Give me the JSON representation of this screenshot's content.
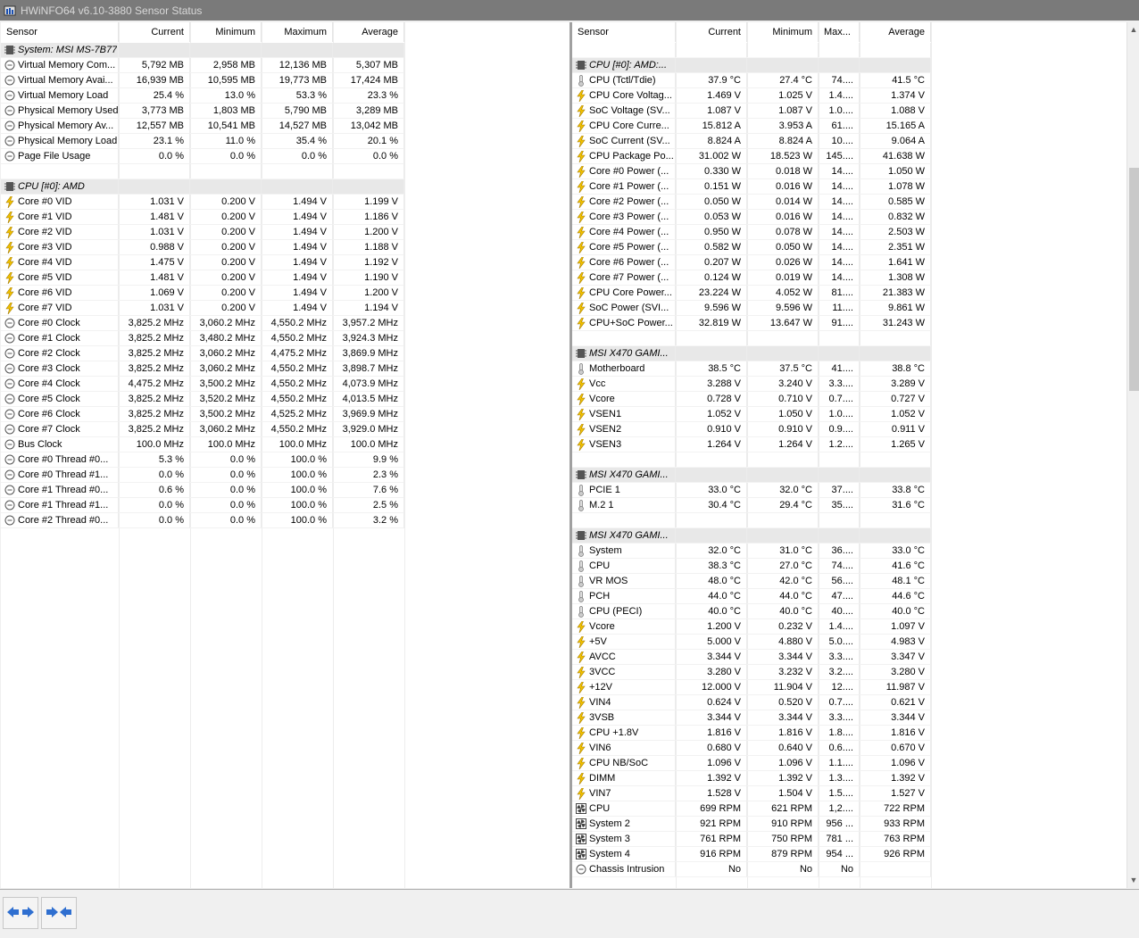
{
  "window": {
    "title": "HWiNFO64 v6.10-3880 Sensor Status"
  },
  "headers": {
    "sensor": "Sensor",
    "current": "Current",
    "minimum": "Minimum",
    "maximum": "Maximum",
    "maximum_short": "Max...",
    "average": "Average"
  },
  "left_rows": [
    {
      "type": "group",
      "name": "System: MSI MS-7B77"
    },
    {
      "type": "row",
      "icon": "circle",
      "name": "Virtual Memory Com...",
      "cur": "5,792 MB",
      "min": "2,958 MB",
      "max": "12,136 MB",
      "avg": "5,307 MB"
    },
    {
      "type": "row",
      "icon": "circle",
      "name": "Virtual Memory Avai...",
      "cur": "16,939 MB",
      "min": "10,595 MB",
      "max": "19,773 MB",
      "avg": "17,424 MB"
    },
    {
      "type": "row",
      "icon": "circle",
      "name": "Virtual Memory Load",
      "cur": "25.4 %",
      "min": "13.0 %",
      "max": "53.3 %",
      "avg": "23.3 %"
    },
    {
      "type": "row",
      "icon": "circle",
      "name": "Physical Memory Used",
      "cur": "3,773 MB",
      "min": "1,803 MB",
      "max": "5,790 MB",
      "avg": "3,289 MB"
    },
    {
      "type": "row",
      "icon": "circle",
      "name": "Physical Memory Av...",
      "cur": "12,557 MB",
      "min": "10,541 MB",
      "max": "14,527 MB",
      "avg": "13,042 MB"
    },
    {
      "type": "row",
      "icon": "circle",
      "name": "Physical Memory Load",
      "cur": "23.1 %",
      "min": "11.0 %",
      "max": "35.4 %",
      "avg": "20.1 %"
    },
    {
      "type": "row",
      "icon": "circle",
      "name": "Page File Usage",
      "cur": "0.0 %",
      "min": "0.0 %",
      "max": "0.0 %",
      "avg": "0.0 %"
    },
    {
      "type": "blank"
    },
    {
      "type": "group",
      "name": "CPU [#0]: AMD"
    },
    {
      "type": "row",
      "icon": "bolt",
      "name": "Core #0 VID",
      "cur": "1.031 V",
      "min": "0.200 V",
      "max": "1.494 V",
      "avg": "1.199 V"
    },
    {
      "type": "row",
      "icon": "bolt",
      "name": "Core #1 VID",
      "cur": "1.481 V",
      "min": "0.200 V",
      "max": "1.494 V",
      "avg": "1.186 V"
    },
    {
      "type": "row",
      "icon": "bolt",
      "name": "Core #2 VID",
      "cur": "1.031 V",
      "min": "0.200 V",
      "max": "1.494 V",
      "avg": "1.200 V"
    },
    {
      "type": "row",
      "icon": "bolt",
      "name": "Core #3 VID",
      "cur": "0.988 V",
      "min": "0.200 V",
      "max": "1.494 V",
      "avg": "1.188 V"
    },
    {
      "type": "row",
      "icon": "bolt",
      "name": "Core #4 VID",
      "cur": "1.475 V",
      "min": "0.200 V",
      "max": "1.494 V",
      "avg": "1.192 V"
    },
    {
      "type": "row",
      "icon": "bolt",
      "name": "Core #5 VID",
      "cur": "1.481 V",
      "min": "0.200 V",
      "max": "1.494 V",
      "avg": "1.190 V"
    },
    {
      "type": "row",
      "icon": "bolt",
      "name": "Core #6 VID",
      "cur": "1.069 V",
      "min": "0.200 V",
      "max": "1.494 V",
      "avg": "1.200 V"
    },
    {
      "type": "row",
      "icon": "bolt",
      "name": "Core #7 VID",
      "cur": "1.031 V",
      "min": "0.200 V",
      "max": "1.494 V",
      "avg": "1.194 V"
    },
    {
      "type": "row",
      "icon": "circle",
      "name": "Core #0 Clock",
      "cur": "3,825.2 MHz",
      "min": "3,060.2 MHz",
      "max": "4,550.2 MHz",
      "avg": "3,957.2 MHz"
    },
    {
      "type": "row",
      "icon": "circle",
      "name": "Core #1 Clock",
      "cur": "3,825.2 MHz",
      "min": "3,480.2 MHz",
      "max": "4,550.2 MHz",
      "avg": "3,924.3 MHz"
    },
    {
      "type": "row",
      "icon": "circle",
      "name": "Core #2 Clock",
      "cur": "3,825.2 MHz",
      "min": "3,060.2 MHz",
      "max": "4,475.2 MHz",
      "avg": "3,869.9 MHz"
    },
    {
      "type": "row",
      "icon": "circle",
      "name": "Core #3 Clock",
      "cur": "3,825.2 MHz",
      "min": "3,060.2 MHz",
      "max": "4,550.2 MHz",
      "avg": "3,898.7 MHz"
    },
    {
      "type": "row",
      "icon": "circle",
      "name": "Core #4 Clock",
      "cur": "4,475.2 MHz",
      "min": "3,500.2 MHz",
      "max": "4,550.2 MHz",
      "avg": "4,073.9 MHz"
    },
    {
      "type": "row",
      "icon": "circle",
      "name": "Core #5 Clock",
      "cur": "3,825.2 MHz",
      "min": "3,520.2 MHz",
      "max": "4,550.2 MHz",
      "avg": "4,013.5 MHz"
    },
    {
      "type": "row",
      "icon": "circle",
      "name": "Core #6 Clock",
      "cur": "3,825.2 MHz",
      "min": "3,500.2 MHz",
      "max": "4,525.2 MHz",
      "avg": "3,969.9 MHz"
    },
    {
      "type": "row",
      "icon": "circle",
      "name": "Core #7 Clock",
      "cur": "3,825.2 MHz",
      "min": "3,060.2 MHz",
      "max": "4,550.2 MHz",
      "avg": "3,929.0 MHz"
    },
    {
      "type": "row",
      "icon": "circle",
      "name": "Bus Clock",
      "cur": "100.0 MHz",
      "min": "100.0 MHz",
      "max": "100.0 MHz",
      "avg": "100.0 MHz"
    },
    {
      "type": "row",
      "icon": "circle",
      "name": "Core #0 Thread #0...",
      "cur": "5.3 %",
      "min": "0.0 %",
      "max": "100.0 %",
      "avg": "9.9 %"
    },
    {
      "type": "row",
      "icon": "circle",
      "name": "Core #0 Thread #1...",
      "cur": "0.0 %",
      "min": "0.0 %",
      "max": "100.0 %",
      "avg": "2.3 %"
    },
    {
      "type": "row",
      "icon": "circle",
      "name": "Core #1 Thread #0...",
      "cur": "0.6 %",
      "min": "0.0 %",
      "max": "100.0 %",
      "avg": "7.6 %"
    },
    {
      "type": "row",
      "icon": "circle",
      "name": "Core #1 Thread #1...",
      "cur": "0.0 %",
      "min": "0.0 %",
      "max": "100.0 %",
      "avg": "2.5 %"
    },
    {
      "type": "row",
      "icon": "circle",
      "name": "Core #2 Thread #0...",
      "cur": "0.0 %",
      "min": "0.0 %",
      "max": "100.0 %",
      "avg": "3.2 %"
    }
  ],
  "right_rows": [
    {
      "type": "blank"
    },
    {
      "type": "group",
      "name": "CPU [#0]: AMD:..."
    },
    {
      "type": "row",
      "icon": "thermo",
      "name": "CPU (Tctl/Tdie)",
      "cur": "37.9 °C",
      "min": "27.4 °C",
      "max": "74....",
      "avg": "41.5 °C"
    },
    {
      "type": "row",
      "icon": "bolt",
      "name": "CPU Core Voltag...",
      "cur": "1.469 V",
      "min": "1.025 V",
      "max": "1.4....",
      "avg": "1.374 V"
    },
    {
      "type": "row",
      "icon": "bolt",
      "name": "SoC Voltage (SV...",
      "cur": "1.087 V",
      "min": "1.087 V",
      "max": "1.0....",
      "avg": "1.088 V"
    },
    {
      "type": "row",
      "icon": "bolt",
      "name": "CPU Core Curre...",
      "cur": "15.812 A",
      "min": "3.953 A",
      "max": "61....",
      "avg": "15.165 A"
    },
    {
      "type": "row",
      "icon": "bolt",
      "name": "SoC Current (SV...",
      "cur": "8.824 A",
      "min": "8.824 A",
      "max": "10....",
      "avg": "9.064 A"
    },
    {
      "type": "row",
      "icon": "bolt",
      "name": "CPU Package Po...",
      "cur": "31.002 W",
      "min": "18.523 W",
      "max": "145....",
      "avg": "41.638 W"
    },
    {
      "type": "row",
      "icon": "bolt",
      "name": "Core #0 Power (...",
      "cur": "0.330 W",
      "min": "0.018 W",
      "max": "14....",
      "avg": "1.050 W"
    },
    {
      "type": "row",
      "icon": "bolt",
      "name": "Core #1 Power (...",
      "cur": "0.151 W",
      "min": "0.016 W",
      "max": "14....",
      "avg": "1.078 W"
    },
    {
      "type": "row",
      "icon": "bolt",
      "name": "Core #2 Power (...",
      "cur": "0.050 W",
      "min": "0.014 W",
      "max": "14....",
      "avg": "0.585 W"
    },
    {
      "type": "row",
      "icon": "bolt",
      "name": "Core #3 Power (...",
      "cur": "0.053 W",
      "min": "0.016 W",
      "max": "14....",
      "avg": "0.832 W"
    },
    {
      "type": "row",
      "icon": "bolt",
      "name": "Core #4 Power (...",
      "cur": "0.950 W",
      "min": "0.078 W",
      "max": "14....",
      "avg": "2.503 W"
    },
    {
      "type": "row",
      "icon": "bolt",
      "name": "Core #5 Power (...",
      "cur": "0.582 W",
      "min": "0.050 W",
      "max": "14....",
      "avg": "2.351 W"
    },
    {
      "type": "row",
      "icon": "bolt",
      "name": "Core #6 Power (...",
      "cur": "0.207 W",
      "min": "0.026 W",
      "max": "14....",
      "avg": "1.641 W"
    },
    {
      "type": "row",
      "icon": "bolt",
      "name": "Core #7 Power (...",
      "cur": "0.124 W",
      "min": "0.019 W",
      "max": "14....",
      "avg": "1.308 W"
    },
    {
      "type": "row",
      "icon": "bolt",
      "name": "CPU Core Power...",
      "cur": "23.224 W",
      "min": "4.052 W",
      "max": "81....",
      "avg": "21.383 W"
    },
    {
      "type": "row",
      "icon": "bolt",
      "name": "SoC Power (SVI...",
      "cur": "9.596 W",
      "min": "9.596 W",
      "max": "11....",
      "avg": "9.861 W"
    },
    {
      "type": "row",
      "icon": "bolt",
      "name": "CPU+SoC Power...",
      "cur": "32.819 W",
      "min": "13.647 W",
      "max": "91....",
      "avg": "31.243 W"
    },
    {
      "type": "blank"
    },
    {
      "type": "group",
      "name": "MSI X470 GAMI..."
    },
    {
      "type": "row",
      "icon": "thermo",
      "name": "Motherboard",
      "cur": "38.5 °C",
      "min": "37.5 °C",
      "max": "41....",
      "avg": "38.8 °C"
    },
    {
      "type": "row",
      "icon": "bolt",
      "name": "Vcc",
      "cur": "3.288 V",
      "min": "3.240 V",
      "max": "3.3....",
      "avg": "3.289 V"
    },
    {
      "type": "row",
      "icon": "bolt",
      "name": "Vcore",
      "cur": "0.728 V",
      "min": "0.710 V",
      "max": "0.7....",
      "avg": "0.727 V"
    },
    {
      "type": "row",
      "icon": "bolt",
      "name": "VSEN1",
      "cur": "1.052 V",
      "min": "1.050 V",
      "max": "1.0....",
      "avg": "1.052 V"
    },
    {
      "type": "row",
      "icon": "bolt",
      "name": "VSEN2",
      "cur": "0.910 V",
      "min": "0.910 V",
      "max": "0.9....",
      "avg": "0.911 V"
    },
    {
      "type": "row",
      "icon": "bolt",
      "name": "VSEN3",
      "cur": "1.264 V",
      "min": "1.264 V",
      "max": "1.2....",
      "avg": "1.265 V"
    },
    {
      "type": "blank"
    },
    {
      "type": "group",
      "name": "MSI X470 GAMI..."
    },
    {
      "type": "row",
      "icon": "thermo",
      "name": "PCIE 1",
      "cur": "33.0 °C",
      "min": "32.0 °C",
      "max": "37....",
      "avg": "33.8 °C"
    },
    {
      "type": "row",
      "icon": "thermo",
      "name": "M.2 1",
      "cur": "30.4 °C",
      "min": "29.4 °C",
      "max": "35....",
      "avg": "31.6 °C"
    },
    {
      "type": "blank"
    },
    {
      "type": "group",
      "name": "MSI X470 GAMI..."
    },
    {
      "type": "row",
      "icon": "thermo",
      "name": "System",
      "cur": "32.0 °C",
      "min": "31.0 °C",
      "max": "36....",
      "avg": "33.0 °C"
    },
    {
      "type": "row",
      "icon": "thermo",
      "name": "CPU",
      "cur": "38.3 °C",
      "min": "27.0 °C",
      "max": "74....",
      "avg": "41.6 °C"
    },
    {
      "type": "row",
      "icon": "thermo",
      "name": "VR MOS",
      "cur": "48.0 °C",
      "min": "42.0 °C",
      "max": "56....",
      "avg": "48.1 °C"
    },
    {
      "type": "row",
      "icon": "thermo",
      "name": "PCH",
      "cur": "44.0 °C",
      "min": "44.0 °C",
      "max": "47....",
      "avg": "44.6 °C"
    },
    {
      "type": "row",
      "icon": "thermo",
      "name": "CPU (PECI)",
      "cur": "40.0 °C",
      "min": "40.0 °C",
      "max": "40....",
      "avg": "40.0 °C"
    },
    {
      "type": "row",
      "icon": "bolt",
      "name": "Vcore",
      "cur": "1.200 V",
      "min": "0.232 V",
      "max": "1.4....",
      "avg": "1.097 V"
    },
    {
      "type": "row",
      "icon": "bolt",
      "name": "+5V",
      "cur": "5.000 V",
      "min": "4.880 V",
      "max": "5.0....",
      "avg": "4.983 V"
    },
    {
      "type": "row",
      "icon": "bolt",
      "name": "AVCC",
      "cur": "3.344 V",
      "min": "3.344 V",
      "max": "3.3....",
      "avg": "3.347 V"
    },
    {
      "type": "row",
      "icon": "bolt",
      "name": "3VCC",
      "cur": "3.280 V",
      "min": "3.232 V",
      "max": "3.2....",
      "avg": "3.280 V"
    },
    {
      "type": "row",
      "icon": "bolt",
      "name": "+12V",
      "cur": "12.000 V",
      "min": "11.904 V",
      "max": "12....",
      "avg": "11.987 V"
    },
    {
      "type": "row",
      "icon": "bolt",
      "name": "VIN4",
      "cur": "0.624 V",
      "min": "0.520 V",
      "max": "0.7....",
      "avg": "0.621 V"
    },
    {
      "type": "row",
      "icon": "bolt",
      "name": "3VSB",
      "cur": "3.344 V",
      "min": "3.344 V",
      "max": "3.3....",
      "avg": "3.344 V"
    },
    {
      "type": "row",
      "icon": "bolt",
      "name": "CPU +1.8V",
      "cur": "1.816 V",
      "min": "1.816 V",
      "max": "1.8....",
      "avg": "1.816 V"
    },
    {
      "type": "row",
      "icon": "bolt",
      "name": "VIN6",
      "cur": "0.680 V",
      "min": "0.640 V",
      "max": "0.6....",
      "avg": "0.670 V"
    },
    {
      "type": "row",
      "icon": "bolt",
      "name": "CPU NB/SoC",
      "cur": "1.096 V",
      "min": "1.096 V",
      "max": "1.1....",
      "avg": "1.096 V"
    },
    {
      "type": "row",
      "icon": "bolt",
      "name": "DIMM",
      "cur": "1.392 V",
      "min": "1.392 V",
      "max": "1.3....",
      "avg": "1.392 V"
    },
    {
      "type": "row",
      "icon": "bolt",
      "name": "VIN7",
      "cur": "1.528 V",
      "min": "1.504 V",
      "max": "1.5....",
      "avg": "1.527 V"
    },
    {
      "type": "row",
      "icon": "fan",
      "name": "CPU",
      "cur": "699 RPM",
      "min": "621 RPM",
      "max": "1,2....",
      "avg": "722 RPM"
    },
    {
      "type": "row",
      "icon": "fan",
      "name": "System 2",
      "cur": "921 RPM",
      "min": "910 RPM",
      "max": "956 ...",
      "avg": "933 RPM"
    },
    {
      "type": "row",
      "icon": "fan",
      "name": "System 3",
      "cur": "761 RPM",
      "min": "750 RPM",
      "max": "781 ...",
      "avg": "763 RPM"
    },
    {
      "type": "row",
      "icon": "fan",
      "name": "System 4",
      "cur": "916 RPM",
      "min": "879 RPM",
      "max": "954 ...",
      "avg": "926 RPM"
    },
    {
      "type": "row",
      "icon": "circle",
      "name": "Chassis Intrusion",
      "cur": "No",
      "min": "No",
      "max": "No",
      "avg": ""
    }
  ],
  "buttons": {
    "expand": "expand-arrows-icon",
    "collapse": "collapse-arrows-icon"
  },
  "colors": {
    "titlebar": "#7a7a7a",
    "group_bg": "#e8e8e8",
    "bolt": "#f2c200",
    "arrow_blue": "#2f6fd0"
  }
}
